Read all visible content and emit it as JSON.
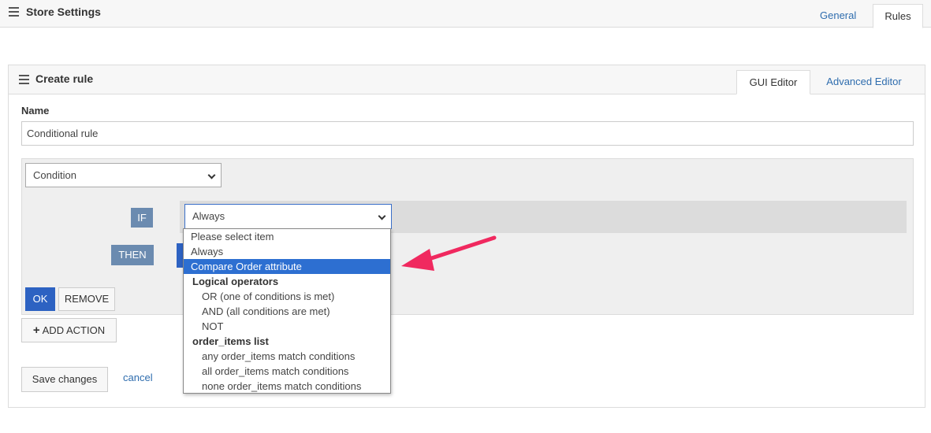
{
  "header": {
    "title": "Store Settings",
    "tabs": [
      {
        "label": "General",
        "active": false
      },
      {
        "label": "Rules",
        "active": true
      }
    ]
  },
  "panel": {
    "title": "Create rule",
    "tabs": [
      {
        "label": "GUI Editor",
        "active": true
      },
      {
        "label": "Advanced Editor",
        "active": false
      }
    ]
  },
  "form": {
    "name_label": "Name",
    "name_value": "Conditional rule",
    "type_select_value": "Condition",
    "if_label": "IF",
    "then_label": "THEN",
    "if_select_value": "Always",
    "ok_label": "OK",
    "remove_label": "REMOVE",
    "add_action_plus": "+",
    "add_action_label": "ADD ACTION",
    "save_label": "Save changes",
    "cancel_label": "cancel"
  },
  "dropdown": {
    "options": [
      {
        "label": "Please select item",
        "kind": "option"
      },
      {
        "label": "Always",
        "kind": "option"
      },
      {
        "label": "Compare Order attribute",
        "kind": "option",
        "highlighted": true
      },
      {
        "label": "Logical operators",
        "kind": "group"
      },
      {
        "label": "OR (one of conditions is met)",
        "kind": "sub"
      },
      {
        "label": "AND (all conditions are met)",
        "kind": "sub"
      },
      {
        "label": "NOT",
        "kind": "sub"
      },
      {
        "label": "order_items list",
        "kind": "group"
      },
      {
        "label": "any order_items match conditions",
        "kind": "sub"
      },
      {
        "label": "all order_items match conditions",
        "kind": "sub"
      },
      {
        "label": "none order_items match conditions",
        "kind": "sub"
      }
    ]
  },
  "colors": {
    "accent_blue": "#2d62c2",
    "highlight": "#2d6fd1",
    "badge": "#6b8bb0",
    "arrow": "#f0295f",
    "link": "#2f6dae"
  }
}
